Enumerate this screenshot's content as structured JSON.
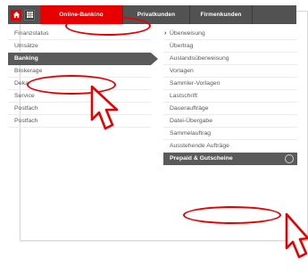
{
  "colors": {
    "accent": "#e60000",
    "nav_bg": "#525252",
    "active_row_bg": "#5a5a5a",
    "text": "#5a5a5a"
  },
  "top_nav": {
    "home_icon": "home-icon",
    "grid_icon": "grid-icon",
    "tabs": [
      {
        "label": "Online-Banking",
        "active": true
      },
      {
        "label": "Privatkunden",
        "active": false
      },
      {
        "label": "Firmenkunden",
        "active": false
      }
    ]
  },
  "left_menu": {
    "items": [
      {
        "label": "Finanzstatus",
        "active": false
      },
      {
        "label": "Umsätze",
        "active": false
      },
      {
        "label": "Banking",
        "active": true
      },
      {
        "label": "Brokerage",
        "active": false
      },
      {
        "label": "Deka",
        "active": false
      },
      {
        "label": "Service",
        "active": false
      },
      {
        "label": "Postfach",
        "active": false
      },
      {
        "label": "Postfach",
        "active": false
      }
    ]
  },
  "right_menu": {
    "items": [
      {
        "label": "Überweisung",
        "current": true
      },
      {
        "label": "Übertrag"
      },
      {
        "label": "Auslandsüberweisung"
      },
      {
        "label": "Vorlagen"
      },
      {
        "label": "Sammler-Vorlagen"
      },
      {
        "label": "Lastschrift"
      },
      {
        "label": "Daueraufträge"
      },
      {
        "label": "Datei-Übergabe"
      },
      {
        "label": "Sammelauftrag"
      },
      {
        "label": "Ausstehende Aufträge"
      },
      {
        "label": "Prepaid & Gutscheine",
        "highlight": true
      }
    ]
  },
  "annotations": {
    "marker_color": "#e60000",
    "cursor_icon": "hand-pointer-icon"
  }
}
